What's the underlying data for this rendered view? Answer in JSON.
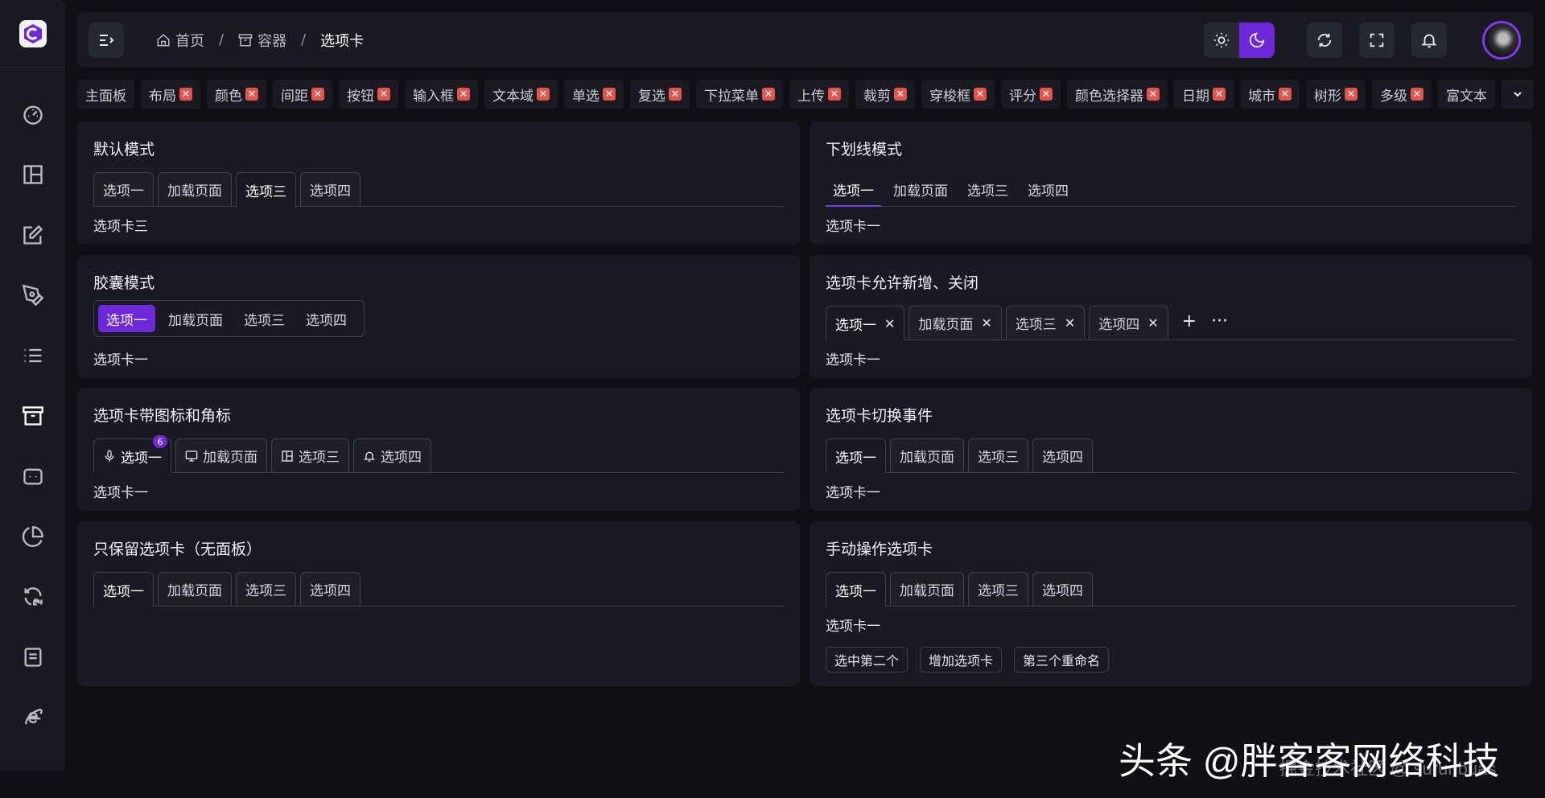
{
  "header": {
    "breadcrumb": [
      "首页",
      "容器",
      "选项卡"
    ]
  },
  "open_tags": [
    "主面板",
    "布局",
    "颜色",
    "间距",
    "按钮",
    "输入框",
    "文本域",
    "单选",
    "复选",
    "下拉菜单",
    "上传",
    "裁剪",
    "穿梭框",
    "评分",
    "颜色选择器",
    "日期",
    "城市",
    "树形",
    "多级",
    "富文本"
  ],
  "panels": {
    "default": {
      "title": "默认模式",
      "tabs": [
        "选项一",
        "加载页面",
        "选项三",
        "选项四"
      ],
      "active_index": 2,
      "content": "选项卡三"
    },
    "underline": {
      "title": "下划线模式",
      "tabs": [
        "选项一",
        "加载页面",
        "选项三",
        "选项四"
      ],
      "active_index": 0,
      "content": "选项卡一"
    },
    "capsule": {
      "title": "胶囊模式",
      "tabs": [
        "选项一",
        "加载页面",
        "选项三",
        "选项四"
      ],
      "active_index": 0,
      "content": "选项卡一"
    },
    "closable": {
      "title": "选项卡允许新增、关闭",
      "tabs": [
        "选项一",
        "加载页面",
        "选项三",
        "选项四"
      ],
      "active_index": 0,
      "content": "选项卡一",
      "add_symbol": "+",
      "more_symbol": "···"
    },
    "icons": {
      "title": "选项卡带图标和角标",
      "tabs": [
        "选项一",
        "加载页面",
        "选项三",
        "选项四"
      ],
      "tab_icons": [
        "mic-icon",
        "monitor-icon",
        "layout-icon",
        "bell-icon"
      ],
      "badge": "6",
      "active_index": 0,
      "content": "选项卡一"
    },
    "switch_event": {
      "title": "选项卡切换事件",
      "tabs": [
        "选项一",
        "加载页面",
        "选项三",
        "选项四"
      ],
      "active_index": 0,
      "content": "选项卡一"
    },
    "no_panel": {
      "title": "只保留选项卡（无面板）",
      "tabs": [
        "选项一",
        "加载页面",
        "选项三",
        "选项四"
      ],
      "active_index": 0
    },
    "manual": {
      "title": "手动操作选项卡",
      "tabs": [
        "选项一",
        "加载页面",
        "选项三",
        "选项四"
      ],
      "active_index": 0,
      "content": "选项卡一",
      "actions": [
        "选中第二个",
        "增加选项卡",
        "第三个重命名"
      ]
    }
  },
  "watermark": {
    "main": "头条 @胖客客网络科技",
    "sub": "掘金技术社区 @ surunbuas"
  },
  "colors": {
    "accent": "#6d28d9",
    "background": "#0f1013",
    "panel": "#1a1b22",
    "close_badge": "#e5534b"
  }
}
